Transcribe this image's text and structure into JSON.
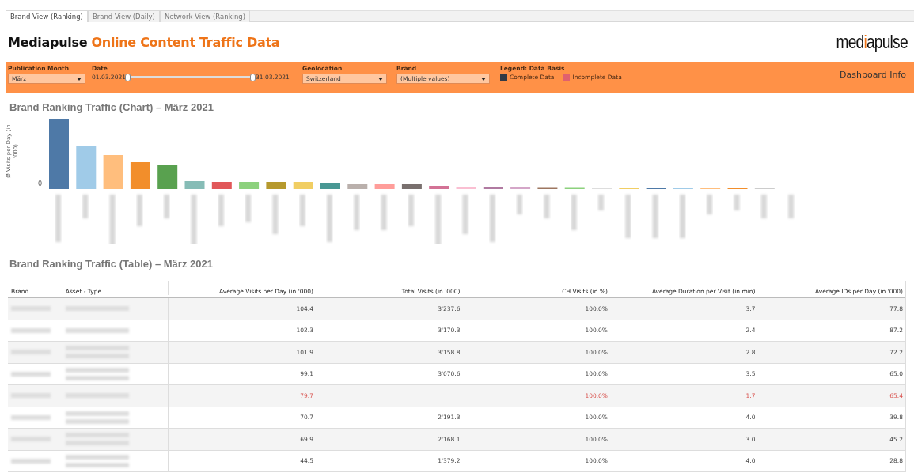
{
  "tabs": [
    {
      "label": "Brand View (Ranking)",
      "selected": true
    },
    {
      "label": "Brand View (Daily)",
      "selected": false
    },
    {
      "label": "Network View (Ranking)",
      "selected": false
    }
  ],
  "title": {
    "brand": "Mediapulse",
    "rest": "Online Content Traffic Data"
  },
  "logo": {
    "before": "med",
    "accent": "i",
    "after": "apulse"
  },
  "filters": {
    "month": {
      "label": "Publication Month",
      "value": "März"
    },
    "date": {
      "label": "Date",
      "from": "01.03.2021",
      "to": "31.03.2021",
      "thumbs": [
        {
          "level": 0
        },
        {
          "level": 1
        }
      ]
    },
    "geo": {
      "label": "Geolocation",
      "value": "Switzerland"
    },
    "brand": {
      "label": "Brand",
      "value": "(Multiple values)"
    }
  },
  "legend": {
    "title": "Legend: Data Basis",
    "items": [
      {
        "label": "Complete Data",
        "color": "#333a45"
      },
      {
        "label": "Incomplete Data",
        "color": "#e0606e"
      }
    ]
  },
  "dashboard_info": "Dashboard Info",
  "chart": {
    "title": "Brand Ranking Traffic (Chart) – März 2021",
    "ylabel": "Ø Visits per Day (in '000)",
    "ytick": "0"
  },
  "table": {
    "title": "Brand Ranking Traffic (Table) – März 2021",
    "columns": [
      "Brand",
      "Asset - Type",
      "Average Visits per Day (in '000)",
      "Total Visits (in '000)",
      "CH Visits (in %)",
      "Average Duration per Visit (in min)",
      "Average IDs per Day (in '000)"
    ],
    "rows": [
      {
        "incomplete": false,
        "avg_visits": "104.4",
        "total_visits": "3'237.6",
        "ch_visits": "100.0%",
        "avg_duration": "3.7",
        "avg_ids": "77.8"
      },
      {
        "incomplete": false,
        "avg_visits": "102.3",
        "total_visits": "3'170.3",
        "ch_visits": "100.0%",
        "avg_duration": "2.4",
        "avg_ids": "87.2"
      },
      {
        "incomplete": false,
        "avg_visits": "101.9",
        "total_visits": "3'158.8",
        "ch_visits": "100.0%",
        "avg_duration": "2.8",
        "avg_ids": "72.2"
      },
      {
        "incomplete": false,
        "avg_visits": "99.1",
        "total_visits": "3'070.6",
        "ch_visits": "100.0%",
        "avg_duration": "3.5",
        "avg_ids": "65.0"
      },
      {
        "incomplete": true,
        "avg_visits": "79.7",
        "ch_visits": "100.0%",
        "avg_duration": "1.7",
        "avg_ids": "65.4"
      },
      {
        "incomplete": false,
        "avg_visits": "70.7",
        "total_visits": "2'191.3",
        "ch_visits": "100.0%",
        "avg_duration": "4.0",
        "avg_ids": "39.8"
      },
      {
        "incomplete": false,
        "avg_visits": "69.9",
        "total_visits": "2'168.1",
        "ch_visits": "100.0%",
        "avg_duration": "3.0",
        "avg_ids": "45.2"
      },
      {
        "incomplete": false,
        "avg_visits": "44.5",
        "total_visits": "1'379.2",
        "ch_visits": "100.0%",
        "avg_duration": "4.0",
        "avg_ids": "28.8"
      }
    ]
  }
}
